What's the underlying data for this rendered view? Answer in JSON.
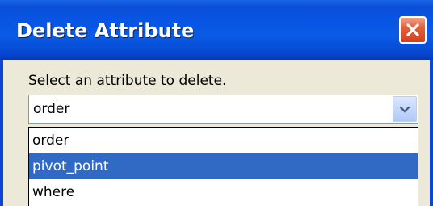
{
  "dialog": {
    "title": "Delete Attribute",
    "close_icon": "close-icon",
    "prompt": "Select an attribute to delete.",
    "combo": {
      "selected_value": "order",
      "arrow_icon": "chevron-down-icon"
    },
    "dropdown": {
      "options": [
        "order",
        "pivot_point",
        "where"
      ],
      "highlighted_option": "pivot_point"
    }
  },
  "colors": {
    "titlebar": "#0a5be6",
    "close_button": "#e2603c",
    "highlight": "#316ac5",
    "dialog_background": "#ece9d8"
  }
}
